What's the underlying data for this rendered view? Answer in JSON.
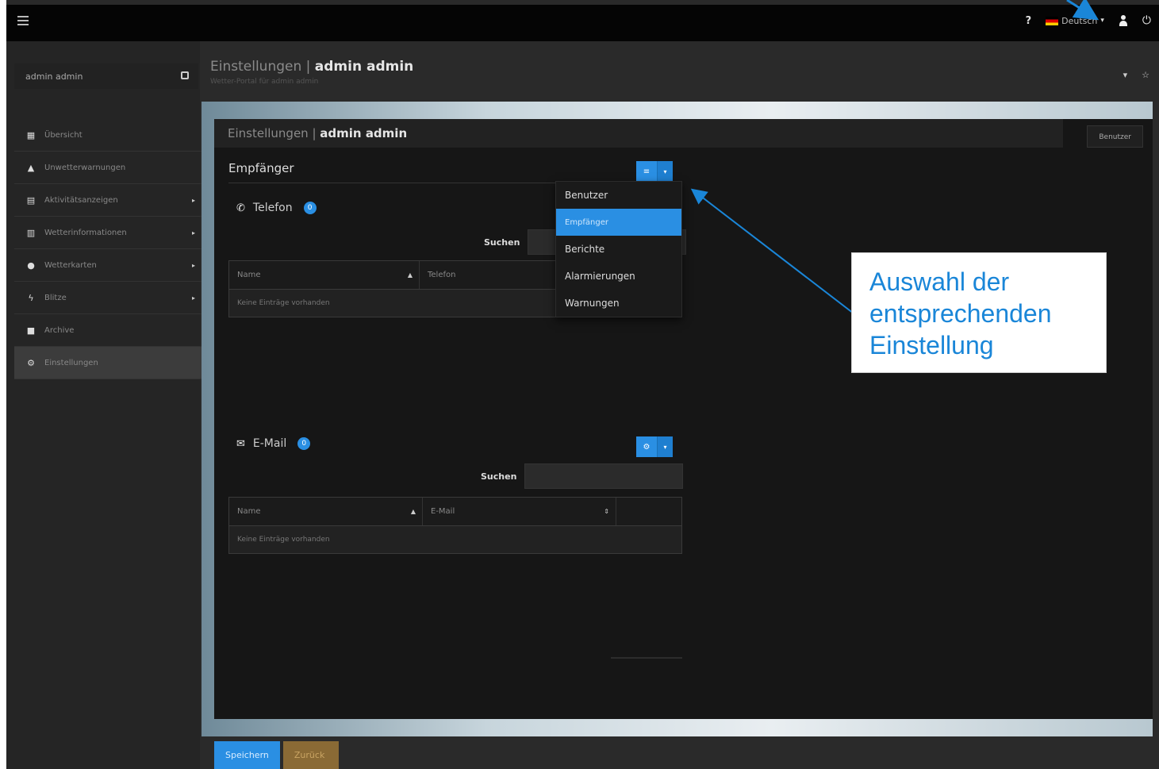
{
  "topbar": {
    "help": "?",
    "language": "Deutsch",
    "icons": [
      "hamburger-icon",
      "flag-de-icon",
      "user-icon",
      "power-icon"
    ]
  },
  "sidebar": {
    "user_name": "admin admin",
    "items": [
      {
        "label": "Übersicht",
        "icon": "dashboard-icon",
        "has_arrow": false
      },
      {
        "label": "Unwetterwarnungen",
        "icon": "warning-icon",
        "has_arrow": false
      },
      {
        "label": "Aktivitätsanzeigen",
        "icon": "table-icon",
        "has_arrow": true
      },
      {
        "label": "Wetterinformationen",
        "icon": "chart-icon",
        "has_arrow": true
      },
      {
        "label": "Wetterkarten",
        "icon": "globe-icon",
        "has_arrow": true
      },
      {
        "label": "Blitze",
        "icon": "bolt-icon",
        "has_arrow": true
      },
      {
        "label": "Archive",
        "icon": "archive-icon",
        "has_arrow": false
      },
      {
        "label": "Einstellungen",
        "icon": "cogs-icon",
        "has_arrow": false,
        "active": true
      }
    ]
  },
  "header": {
    "title_prefix": "Einstellungen | ",
    "title_bold": "admin admin",
    "subtitle": "Wetter-Portal für admin admin"
  },
  "panel": {
    "title_prefix": "Einstellungen | ",
    "title_bold": "admin admin",
    "tab_label": "Benutzer",
    "section_title": "Empfänger",
    "telefon": {
      "title": "Telefon",
      "count": "0",
      "search_label": "Suchen",
      "col_name": "Name",
      "col_value": "Telefon",
      "empty": "Keine Einträge vorhanden"
    },
    "email": {
      "title": "E-Mail",
      "count": "0",
      "search_label": "Suchen",
      "col_name": "Name",
      "col_value": "E-Mail",
      "empty": "Keine Einträge vorhanden"
    }
  },
  "dropdown": {
    "items": [
      "Benutzer",
      "Empfänger",
      "Berichte",
      "Alarmierungen",
      "Warnungen"
    ],
    "active_index": 1
  },
  "footer": {
    "save": "Speichern",
    "cancel": "Zurück"
  },
  "annotation": {
    "line1": "Auswahl der",
    "line2": "entsprechenden",
    "line3": "Einstellung",
    "color": "#1a86d8"
  },
  "colors": {
    "accent": "#2a8fe3",
    "background": "#2a2a2a",
    "topbar": "#050505"
  }
}
